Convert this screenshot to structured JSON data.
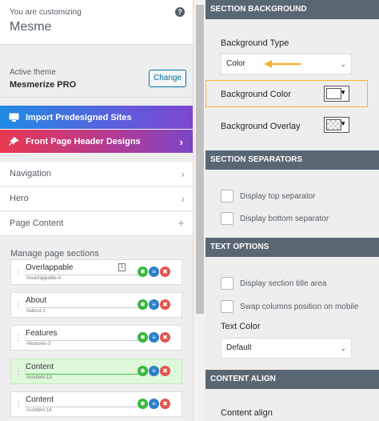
{
  "header": {
    "customizing_label": "You are customizing",
    "site_title": "Mesme",
    "help_icon": "?"
  },
  "theme": {
    "active_label": "Active theme",
    "name": "Mesmerize PRO",
    "change_label": "Change"
  },
  "promo": [
    {
      "label": "Import Predesigned Sites",
      "icon": "monitor-icon"
    },
    {
      "label": "Front Page Header Designs",
      "icon": "pin-icon",
      "arrow": "›"
    }
  ],
  "nav": [
    {
      "label": "Navigation",
      "arrow": "›"
    },
    {
      "label": "Hero",
      "arrow": "›"
    },
    {
      "label": "Page Content",
      "arrow": "+"
    }
  ],
  "manage_title": "Manage page sections",
  "sections": [
    {
      "label": "Overlappable",
      "sub": "#overlappable-4",
      "badge": "1"
    },
    {
      "label": "About",
      "sub": "#about-1"
    },
    {
      "label": "Features",
      "sub": "#features-3"
    },
    {
      "label": "Content",
      "sub": "#content-13"
    },
    {
      "label": "Content",
      "sub": "#content-14"
    }
  ],
  "right": {
    "section_background": "SECTION BACKGROUND",
    "bg_type_label": "Background Type",
    "bg_type_value": "Color",
    "bg_color_label": "Background Color",
    "bg_overlay_label": "Background Overlay",
    "section_separators": "SECTION SEPARATORS",
    "top_sep": "Display top separator",
    "bottom_sep": "Display bottom separator",
    "text_options": "TEXT OPTIONS",
    "title_area": "Display section title area",
    "swap_columns": "Swap columns position on mobile",
    "text_color_label": "Text Color",
    "text_color_value": "Default",
    "content_align": "CONTENT ALIGN",
    "content_align_label": "Content align"
  },
  "colors": {
    "accent": "#0071a1",
    "highlight": "#f4b23a",
    "arrow": "#f4b23a",
    "active_section": "#dff7db",
    "header_bar": "#596773"
  }
}
